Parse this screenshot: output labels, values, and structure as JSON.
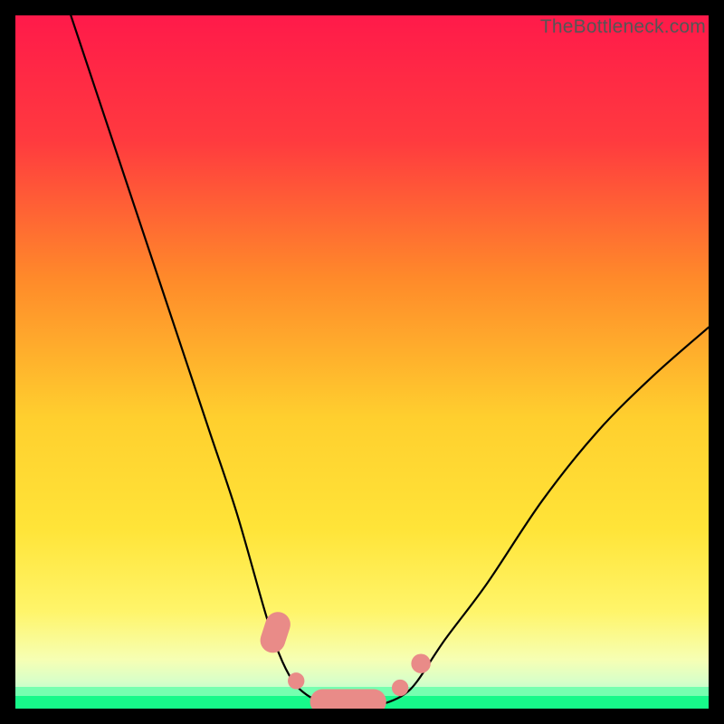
{
  "watermark": "TheBottleneck.com",
  "chart_data": {
    "type": "line",
    "title": "",
    "xlabel": "",
    "ylabel": "",
    "xlim": [
      0,
      100
    ],
    "ylim": [
      0,
      100
    ],
    "legend": false,
    "grid": false,
    "background_gradient": {
      "top": "#ff1a4a",
      "upper_mid": "#ff8a2a",
      "mid": "#ffe438",
      "lower_mid": "#f4ff6a",
      "green_band": "#17f98a",
      "green_band_y_range": [
        0,
        4
      ]
    },
    "series": [
      {
        "name": "bottleneck-curve",
        "x": [
          8,
          12,
          16,
          20,
          24,
          28,
          32,
          36,
          38,
          40,
          42,
          44,
          46,
          48,
          50,
          52,
          54,
          56,
          58,
          62,
          68,
          76,
          84,
          92,
          100
        ],
        "y": [
          100,
          88,
          76,
          64,
          52,
          40,
          28,
          14,
          8,
          4,
          2,
          1,
          0.5,
          0.5,
          0.5,
          0.5,
          1,
          2,
          4,
          10,
          18,
          30,
          40,
          48,
          55
        ]
      }
    ],
    "markers": [
      {
        "shape": "capsule",
        "cx": 37.5,
        "cy": 11,
        "len": 6,
        "angle_deg": -72,
        "color": "#e98b88"
      },
      {
        "shape": "dot",
        "cx": 40.5,
        "cy": 4.0,
        "r": 1.2,
        "color": "#e98b88"
      },
      {
        "shape": "capsule",
        "cx": 48.0,
        "cy": 1.0,
        "len": 11,
        "angle_deg": 0,
        "color": "#e98b88"
      },
      {
        "shape": "dot",
        "cx": 55.5,
        "cy": 3.0,
        "r": 1.2,
        "color": "#e98b88"
      },
      {
        "shape": "dot",
        "cx": 58.5,
        "cy": 6.5,
        "r": 1.4,
        "color": "#e98b88"
      }
    ]
  }
}
